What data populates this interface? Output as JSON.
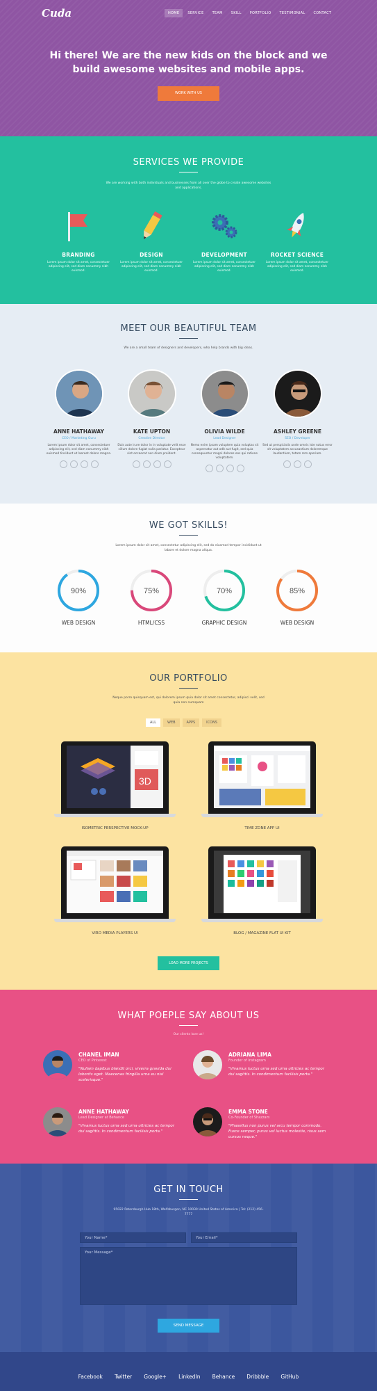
{
  "brand": "Cuda",
  "nav": [
    "HOME",
    "SERVICE",
    "TEAM",
    "SKILL",
    "PORTFOLIO",
    "TESTIMONIAL",
    "CONTACT"
  ],
  "hero": {
    "headline": "Hi there! We are the new kids on the block and we build awesome websites and mobile apps.",
    "cta": "WORK WITH US"
  },
  "services": {
    "title": "SERVICES WE PROVIDE",
    "subtitle": "We are working with both individuals and businesses from all over the globe to create awesome websites and applications.",
    "items": [
      {
        "title": "BRANDING",
        "text": "Lorem ipsum dolor sit amet, consectetuer adipiscing elit, sed diam nonummy nibh euismod.",
        "icon": "flag-icon"
      },
      {
        "title": "DESIGN",
        "text": "Lorem ipsum dolor sit amet, consectetuer adipiscing elit, sed diam nonummy nibh euismod.",
        "icon": "pencil-icon"
      },
      {
        "title": "DEVELOPMENT",
        "text": "Lorem ipsum dolor sit amet, consectetuer adipiscing elit, sed diam nonummy nibh euismod.",
        "icon": "gears-icon"
      },
      {
        "title": "ROCKET SCIENCE",
        "text": "Lorem ipsum dolor sit amet, consectetuer adipiscing elit, sed diam nonummy nibh euismod.",
        "icon": "rocket-icon"
      }
    ]
  },
  "team": {
    "title": "MEET OUR BEAUTIFUL TEAM",
    "subtitle": "We are a small team of designers and developers, who help brands with big ideas.",
    "members": [
      {
        "name": "ANNE HATHAWAY",
        "role": "CEO / Marketing Guru",
        "text": "Lorem ipsum dolor sit amet, consectetuer adipiscing elit, sed diam nonummy nibh euismod tincidunt ut laoreet dolore magna.",
        "socials": 4
      },
      {
        "name": "KATE UPTON",
        "role": "Creative Director",
        "text": "Duis aute irure dolor in in voluptate velit esse cillum dolore fugiat nulla pariatur. Excepteur sint occaecat non diam proident.",
        "socials": 4
      },
      {
        "name": "OLIVIA WILDE",
        "role": "Lead Designer",
        "text": "Nemo enim ipsam voluptem quia voluptas sit aspernatur aut odit aut fugit, sed quia consequuntur magni dolores eos qui ratione voluptatem.",
        "socials": 4
      },
      {
        "name": "ASHLEY GREENE",
        "role": "SEO / Developer",
        "text": "Sed ut perspiciatis unde omnis iste natus error sit voluptatem accusantium doloremque laudantium, totam rem aperiam.",
        "socials": 3
      }
    ]
  },
  "skills": {
    "title": "WE GOT SKILLS!",
    "subtitle": "Lorem ipsum dolor sit amet, consectetur adipiscing elit, sed do eiusmod tempor incididunt ut labore et dolore magna aliqua.",
    "items": [
      {
        "label": "WEB DESIGN",
        "percent": 90,
        "display": "90%",
        "color": "#2ea7e0"
      },
      {
        "label": "HTML/CSS",
        "percent": 75,
        "display": "75%",
        "color": "#d9487a"
      },
      {
        "label": "GRAPHIC DESIGN",
        "percent": 70,
        "display": "70%",
        "color": "#23c09f"
      },
      {
        "label": "WEB DESIGN",
        "percent": 85,
        "display": "85%",
        "color": "#ef7a3b"
      }
    ]
  },
  "portfolio": {
    "title": "OUR PORTFOLIO",
    "subtitle": "Neque porro quisquam est, qui dolorem ipsum quia dolor sit amet consectetur, adipisci velit, sed quia non numquam",
    "filters": [
      "ALL",
      "WEB",
      "APPS",
      "ICONS"
    ],
    "projects": [
      {
        "caption": "ISOMETRIC PERSPECTIVE MOCK-UP"
      },
      {
        "caption": "TIME ZONE APP UI"
      },
      {
        "caption": "VIRO MEDIA PLAYERS UI"
      },
      {
        "caption": "BLOG / MAGAZINE FLAT UI KIT"
      }
    ],
    "load_more": "LOAD MORE PROJECTS"
  },
  "testimonials": {
    "title": "WHAT POEPLE SAY ABOUT US",
    "subtitle": "Our clients love us!",
    "items": [
      {
        "name": "CHANEL IMAN",
        "role": "CEO of Pinterest",
        "quote": "\"Nullam dapibus blandit orci, viverra gravida dui lobortis eget. Maecenas fringilla urna eu nisl scelerisque.\""
      },
      {
        "name": "ADRIANA LIMA",
        "role": "Founder of Instagram",
        "quote": "\"Vivamus luctus urna sed urna ultricies ac tempor dui sagittis. In condimentum facilisis porta.\""
      },
      {
        "name": "ANNE HATHAWAY",
        "role": "Lead Designer at Behance",
        "quote": "\"Vivamus luctus urna sed urna ultricies ac tempor dui sagittis. In condimentum facilisis porta.\""
      },
      {
        "name": "EMMA STONE",
        "role": "Co-Founder of Shazzam",
        "quote": "\"Phasellus non purus vel arcu tempor commodo. Fusce semper, purus vel luctus molestie, risus sem cursus neque.\""
      }
    ]
  },
  "contact": {
    "title": "GET IN TOUCH",
    "address": "95022 Petersburgh Hub 18th, Wolfsburgen, NC 10030 United States of America | Tel: (212) 456-7777",
    "name_placeholder": "Your Name*",
    "email_placeholder": "Your Email*",
    "message_placeholder": "Your Message*",
    "send": "SEND MESSAGE"
  },
  "footer": {
    "links": [
      "Facebook",
      "Twitter",
      "Google+",
      "LinkedIn",
      "Behance",
      "Dribbble",
      "GitHub"
    ]
  },
  "colors": {
    "purple": "#8f55a3",
    "teal": "#23c09f",
    "orange": "#ef7a3b",
    "pink": "#e85185",
    "navy": "#3c579e"
  }
}
